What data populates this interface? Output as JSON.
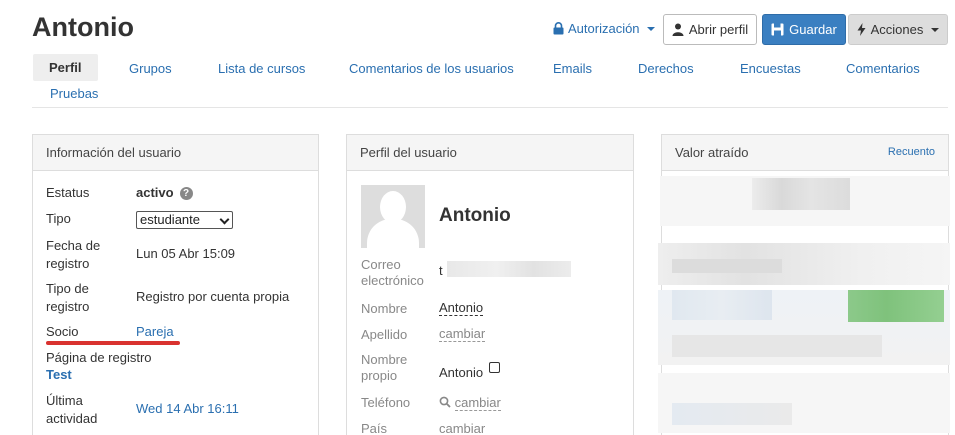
{
  "page": {
    "title": "Antonio"
  },
  "toolbar": {
    "auth_label": "Autorización",
    "open_profile_label": "Abrir perfil",
    "save_label": "Guardar",
    "actions_label": "Acciones"
  },
  "tabs": [
    {
      "label": "Perfil",
      "active": true
    },
    {
      "label": "Grupos"
    },
    {
      "label": "Lista de cursos"
    },
    {
      "label": "Comentarios de los usuarios"
    },
    {
      "label": "Emails"
    },
    {
      "label": "Derechos"
    },
    {
      "label": "Encuestas"
    },
    {
      "label": "Comentarios"
    },
    {
      "label": "Pruebas"
    }
  ],
  "user_info": {
    "heading": "Información del usuario",
    "status_label": "Estatus",
    "status_value": "activo",
    "type_label": "Tipo",
    "type_value": "estudiante",
    "reg_date_label_1": "Fecha de",
    "reg_date_label_2": "registro",
    "reg_date_value": "Lun 05 Abr 15:09",
    "reg_type_label_1": "Tipo de",
    "reg_type_label_2": "registro",
    "reg_type_value": "Registro por cuenta propia",
    "partner_label": "Socio",
    "partner_value": "Pareja",
    "reg_page_label": "Página de registro",
    "reg_page_value": "Test",
    "last_activity_label_1": "Última",
    "last_activity_label_2": "actividad",
    "last_activity_value": "Wed 14 Abr 16:11"
  },
  "user_profile": {
    "heading": "Perfil del usuario",
    "name": "Antonio",
    "email_label_1": "Correo",
    "email_label_2": "electrónico",
    "email_value_prefix": "t",
    "first_name_label": "Nombre",
    "first_name_value": "Antonio",
    "last_name_label": "Apellido",
    "last_name_value": "cambiar",
    "own_name_label_1": "Nombre",
    "own_name_label_2": "propio",
    "own_name_value": "Antonio",
    "phone_label": "Teléfono",
    "phone_value": "cambiar",
    "country_label": "País",
    "country_value": "cambiar"
  },
  "value_panel": {
    "heading": "Valor atraído",
    "link": "Recuento"
  },
  "colors": {
    "accent": "#2a6fb0",
    "primary_button": "#3a7fc1",
    "underline_red": "#d9322f",
    "highlight_green": "#7fc27c"
  }
}
